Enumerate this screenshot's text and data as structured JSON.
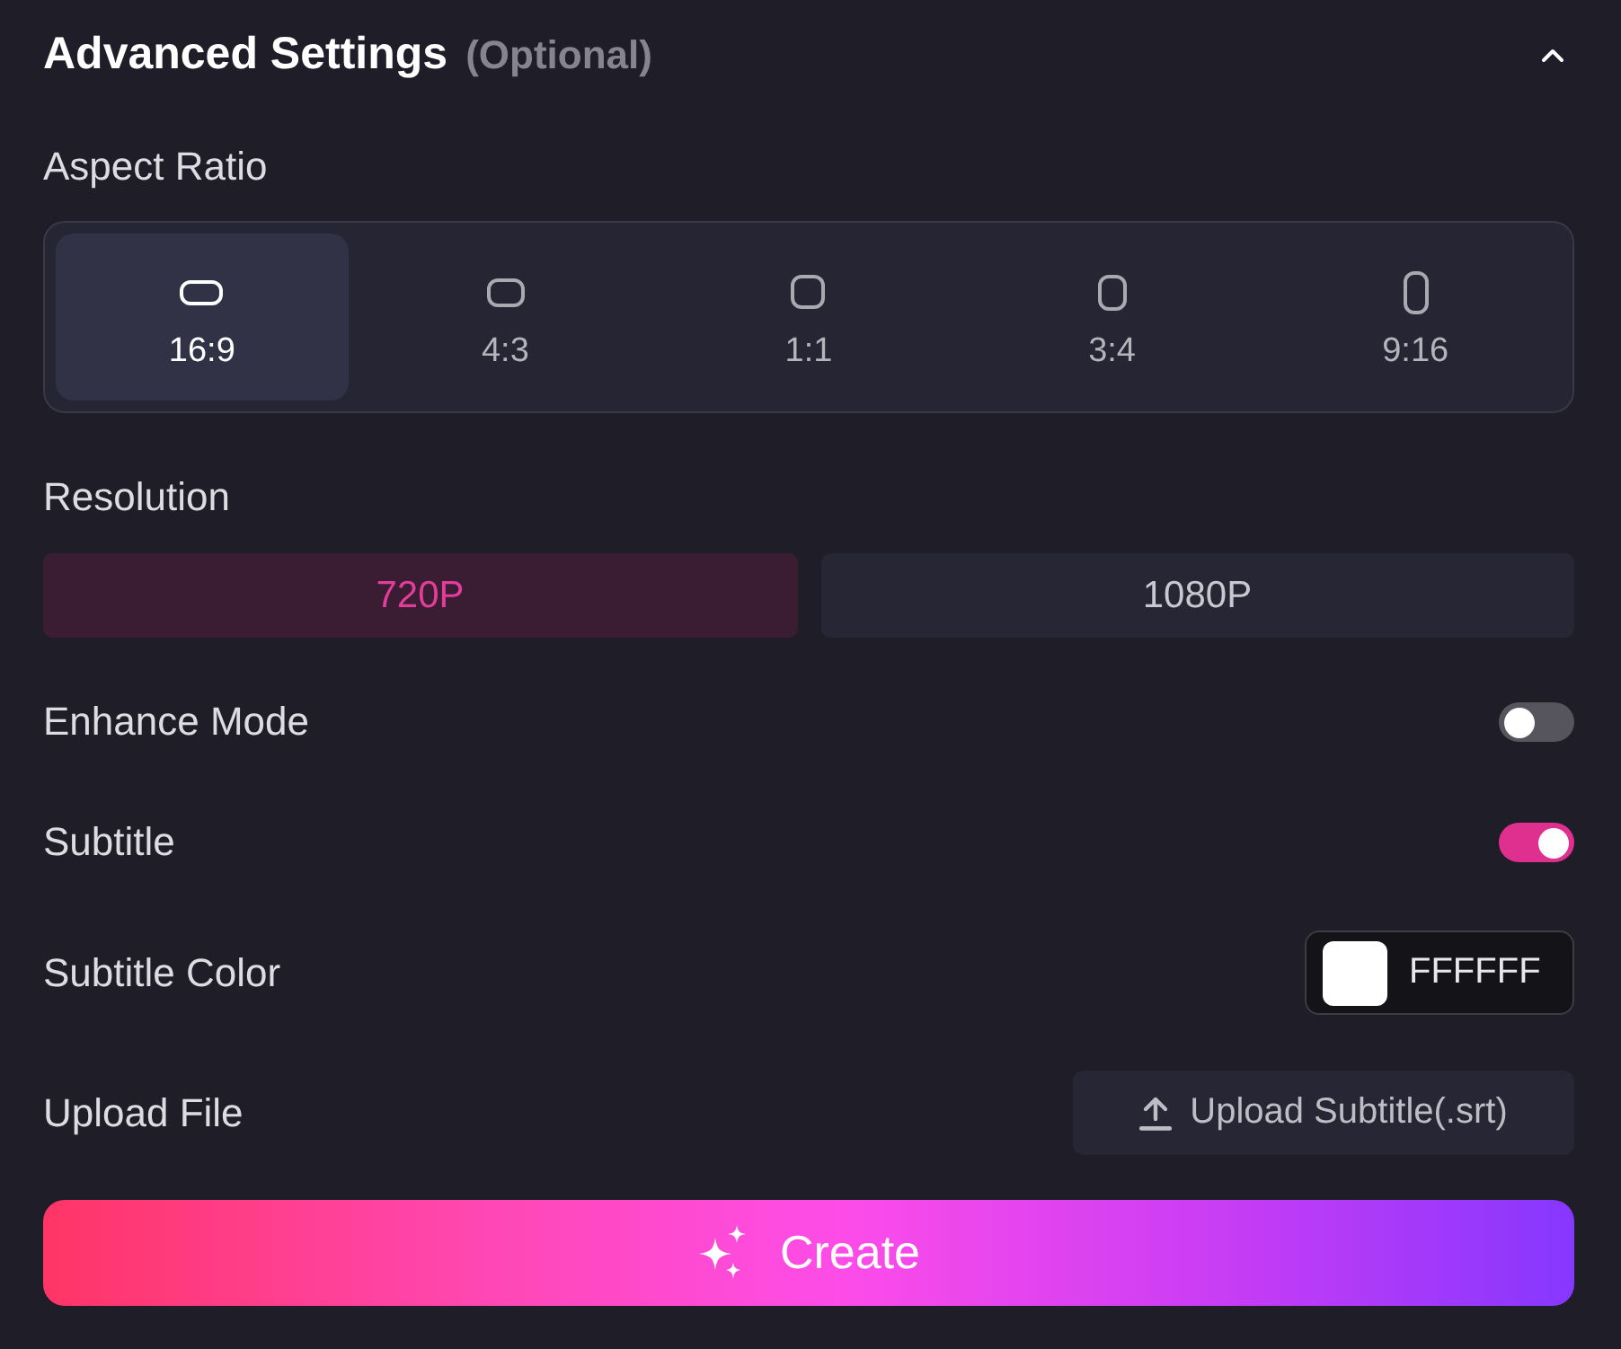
{
  "header": {
    "title": "Advanced Settings",
    "note": "(Optional)",
    "expanded": true
  },
  "aspect_ratio": {
    "label": "Aspect Ratio",
    "options": [
      {
        "label": "16:9",
        "kind": "wide",
        "selected": true
      },
      {
        "label": "4:3",
        "kind": "landscape",
        "selected": false
      },
      {
        "label": "1:1",
        "kind": "square",
        "selected": false
      },
      {
        "label": "3:4",
        "kind": "portrait",
        "selected": false
      },
      {
        "label": "9:16",
        "kind": "tall",
        "selected": false
      }
    ]
  },
  "resolution": {
    "label": "Resolution",
    "options": [
      {
        "label": "720P",
        "selected": true
      },
      {
        "label": "1080P",
        "selected": false
      }
    ]
  },
  "settings": [
    {
      "kind": "toggle",
      "label": "Enhance Mode",
      "on": false
    },
    {
      "kind": "toggle",
      "label": "Subtitle",
      "on": true
    },
    {
      "kind": "color",
      "label": "Subtitle Color",
      "value": "FFFFFF"
    },
    {
      "kind": "upload",
      "label": "Upload File",
      "button": "Upload Subtitle(.srt)"
    }
  ],
  "create_button": {
    "label": "Create"
  }
}
